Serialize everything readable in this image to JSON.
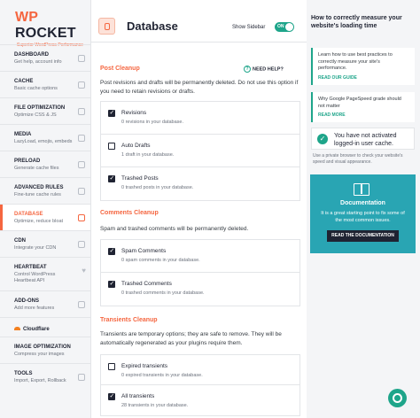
{
  "logo": {
    "brand_a": "WP",
    "brand_b": " ROCKET",
    "tagline": "Superior WordPress Performance"
  },
  "nav": [
    {
      "title": "DASHBOARD",
      "sub": "Get help, account info"
    },
    {
      "title": "CACHE",
      "sub": "Basic cache options"
    },
    {
      "title": "FILE OPTIMIZATION",
      "sub": "Optimize CSS & JS"
    },
    {
      "title": "MEDIA",
      "sub": "LazyLoad, emojis, embeds"
    },
    {
      "title": "PRELOAD",
      "sub": "Generate cache files"
    },
    {
      "title": "ADVANCED RULES",
      "sub": "Fine-tune cache rules"
    },
    {
      "title": "DATABASE",
      "sub": "Optimize, reduce bloat"
    },
    {
      "title": "CDN",
      "sub": "Integrate your CDN"
    },
    {
      "title": "HEARTBEAT",
      "sub": "Control WordPress Heartbeat API"
    },
    {
      "title": "ADD-ONS",
      "sub": "Add more features"
    },
    {
      "title": "Cloudflare",
      "sub": ""
    },
    {
      "title": "IMAGE OPTIMIZATION",
      "sub": "Compress your images"
    },
    {
      "title": "TOOLS",
      "sub": "Import, Export, Rollback"
    }
  ],
  "header": {
    "title": "Database",
    "show_sidebar": "Show Sidebar",
    "toggle": "ON"
  },
  "need_help": "NEED HELP?",
  "post_cleanup": {
    "heading": "Post Cleanup",
    "desc": "Post revisions and drafts will be permanently deleted. Do not use this option if you need to retain revisions or drafts.",
    "options": [
      {
        "label": "Revisions",
        "sub": "0 revisions in your database.",
        "checked": true
      },
      {
        "label": "Auto Drafts",
        "sub": "1 draft in your database.",
        "checked": false
      },
      {
        "label": "Trashed Posts",
        "sub": "0 trashed posts in your database.",
        "checked": true
      }
    ]
  },
  "comments_cleanup": {
    "heading": "Comments Cleanup",
    "desc": "Spam and trashed comments will be permanently deleted.",
    "options": [
      {
        "label": "Spam Comments",
        "sub": "0 spam comments in your database.",
        "checked": true
      },
      {
        "label": "Trashed Comments",
        "sub": "0 trashed comments in your database.",
        "checked": true
      }
    ]
  },
  "transients_cleanup": {
    "heading": "Transients Cleanup",
    "desc": "Transients are temporary options; they are safe to remove. They will be automatically regenerated as your plugins require them.",
    "options": [
      {
        "label": "Expired transients",
        "sub": "0 expired transients in your database.",
        "checked": false
      },
      {
        "label": "All transients",
        "sub": "28 transients in your database.",
        "checked": true
      }
    ]
  },
  "right": {
    "title": "How to correctly measure your website's loading time",
    "card1_text": "Learn how to use best practices to correctly measure your site's performance.",
    "card1_link": "READ OUR GUIDE",
    "card2_text": "Why Google PageSpeed grade should not matter",
    "card2_link": "READ MORE",
    "warning": "You have not activated logged-in user cache.",
    "warning_sub": "Use a private browser to check your website's speed and visual appearance.",
    "doc_title": "Documentation",
    "doc_desc": "It is a great starting point to fix some of the most common issues.",
    "doc_button": "READ THE DOCUMENTATION"
  },
  "colors": {
    "accent": "#f56640",
    "teal": "#1ea58a",
    "doc_bg": "#29a5b3",
    "dark": "#1f2332"
  }
}
